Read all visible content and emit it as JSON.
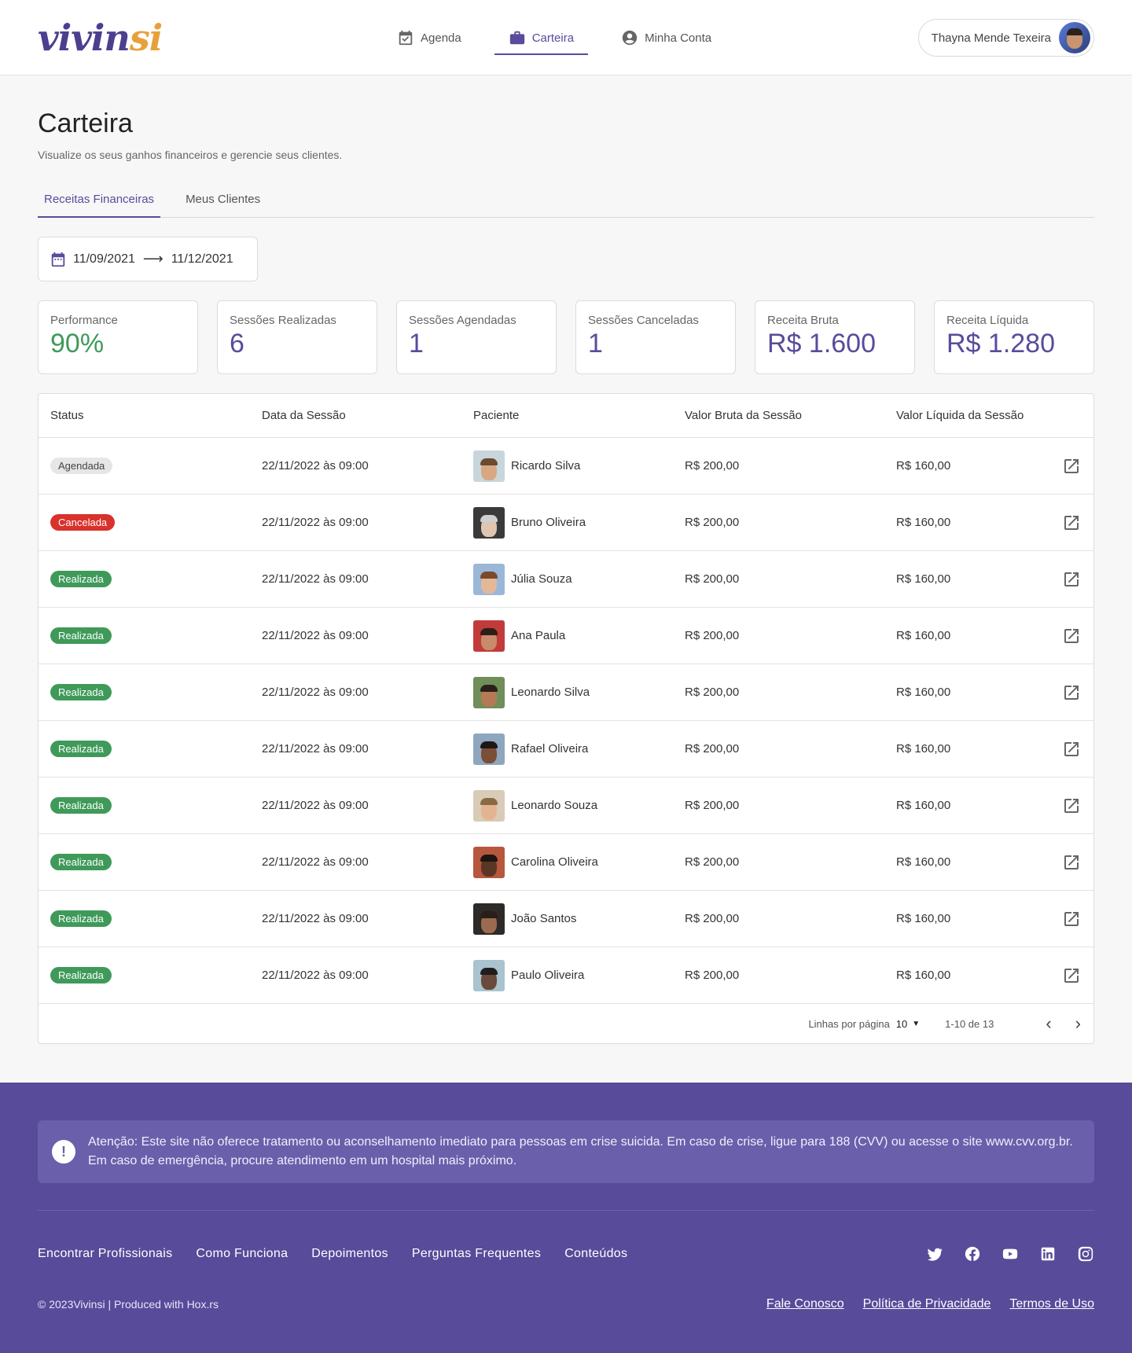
{
  "brand": {
    "logo_text_a": "vivin",
    "logo_text_b": "si"
  },
  "nav": {
    "items": [
      {
        "label": "Agenda",
        "icon": "calendar-check-icon"
      },
      {
        "label": "Carteira",
        "icon": "briefcase-icon",
        "active": true
      },
      {
        "label": "Minha Conta",
        "icon": "account-circle-icon"
      }
    ]
  },
  "user": {
    "name": "Thayna Mende Texeira"
  },
  "page": {
    "title": "Carteira",
    "subtitle": "Visualize os seus ganhos financeiros e gerencie seus clientes."
  },
  "tabs": [
    {
      "label": "Receitas Financeiras",
      "active": true
    },
    {
      "label": "Meus Clientes"
    }
  ],
  "date_range": {
    "start": "11/09/2021",
    "end": "11/12/2021"
  },
  "stats": [
    {
      "label": "Performance",
      "value": "90%"
    },
    {
      "label": "Sessões Realizadas",
      "value": "6"
    },
    {
      "label": "Sessões Agendadas",
      "value": "1"
    },
    {
      "label": "Sessões Canceladas",
      "value": "1"
    },
    {
      "label": "Receita Bruta",
      "value": "R$ 1.600"
    },
    {
      "label": "Receita Líquida",
      "value": "R$ 1.280"
    }
  ],
  "table": {
    "headers": [
      "Status",
      "Data da Sessão",
      "Paciente",
      "Valor Bruta da Sessão",
      "Valor Líquida da Sessão"
    ],
    "rows": [
      {
        "status": "Agendada",
        "date": "22/11/2022 às 09:00",
        "patient": "Ricardo Silva",
        "gross": "R$ 200,00",
        "net": "R$ 160,00"
      },
      {
        "status": "Cancelada",
        "date": "22/11/2022 às 09:00",
        "patient": "Bruno Oliveira",
        "gross": "R$ 200,00",
        "net": "R$ 160,00"
      },
      {
        "status": "Realizada",
        "date": "22/11/2022 às 09:00",
        "patient": "Júlia Souza",
        "gross": "R$ 200,00",
        "net": "R$ 160,00"
      },
      {
        "status": "Realizada",
        "date": "22/11/2022 às 09:00",
        "patient": "Ana Paula",
        "gross": "R$ 200,00",
        "net": "R$ 160,00"
      },
      {
        "status": "Realizada",
        "date": "22/11/2022 às 09:00",
        "patient": "Leonardo Silva",
        "gross": "R$ 200,00",
        "net": "R$ 160,00"
      },
      {
        "status": "Realizada",
        "date": "22/11/2022 às 09:00",
        "patient": "Rafael Oliveira",
        "gross": "R$ 200,00",
        "net": "R$ 160,00"
      },
      {
        "status": "Realizada",
        "date": "22/11/2022 às 09:00",
        "patient": "Leonardo Souza",
        "gross": "R$ 200,00",
        "net": "R$ 160,00"
      },
      {
        "status": "Realizada",
        "date": "22/11/2022 às 09:00",
        "patient": "Carolina Oliveira",
        "gross": "R$ 200,00",
        "net": "R$ 160,00"
      },
      {
        "status": "Realizada",
        "date": "22/11/2022 às 09:00",
        "patient": "João Santos",
        "gross": "R$ 200,00",
        "net": "R$ 160,00"
      },
      {
        "status": "Realizada",
        "date": "22/11/2022 às 09:00",
        "patient": "Paulo Oliveira",
        "gross": "R$ 200,00",
        "net": "R$ 160,00"
      }
    ]
  },
  "pagination": {
    "rows_per_page_label": "Linhas por página",
    "rows_per_page": "10",
    "range": "1-10 de 13"
  },
  "footer": {
    "alert": "Atenção: Este site não oferece tratamento ou aconselhamento imediato para pessoas em crise suicida. Em caso de crise, ligue para 188 (CVV) ou acesse o site www.cvv.org.br. Em caso de emergência, procure atendimento em um hospital mais próximo.",
    "links": [
      "Encontrar Profissionais",
      "Como Funciona",
      "Depoimentos",
      "Perguntas Frequentes",
      "Conteúdos"
    ],
    "socials": [
      "twitter-icon",
      "facebook-icon",
      "youtube-icon",
      "linkedin-icon",
      "instagram-icon"
    ],
    "copyright": "© 2023Vivinsi | Produced with Hox.rs",
    "legal": [
      "Fale Conosco",
      "Política de Privacidade",
      "Termos de Uso"
    ]
  },
  "colors": {
    "brand": "#574b9a",
    "accent": "#5a4b9c",
    "success": "#3f9a5a",
    "danger": "#d9312b"
  }
}
